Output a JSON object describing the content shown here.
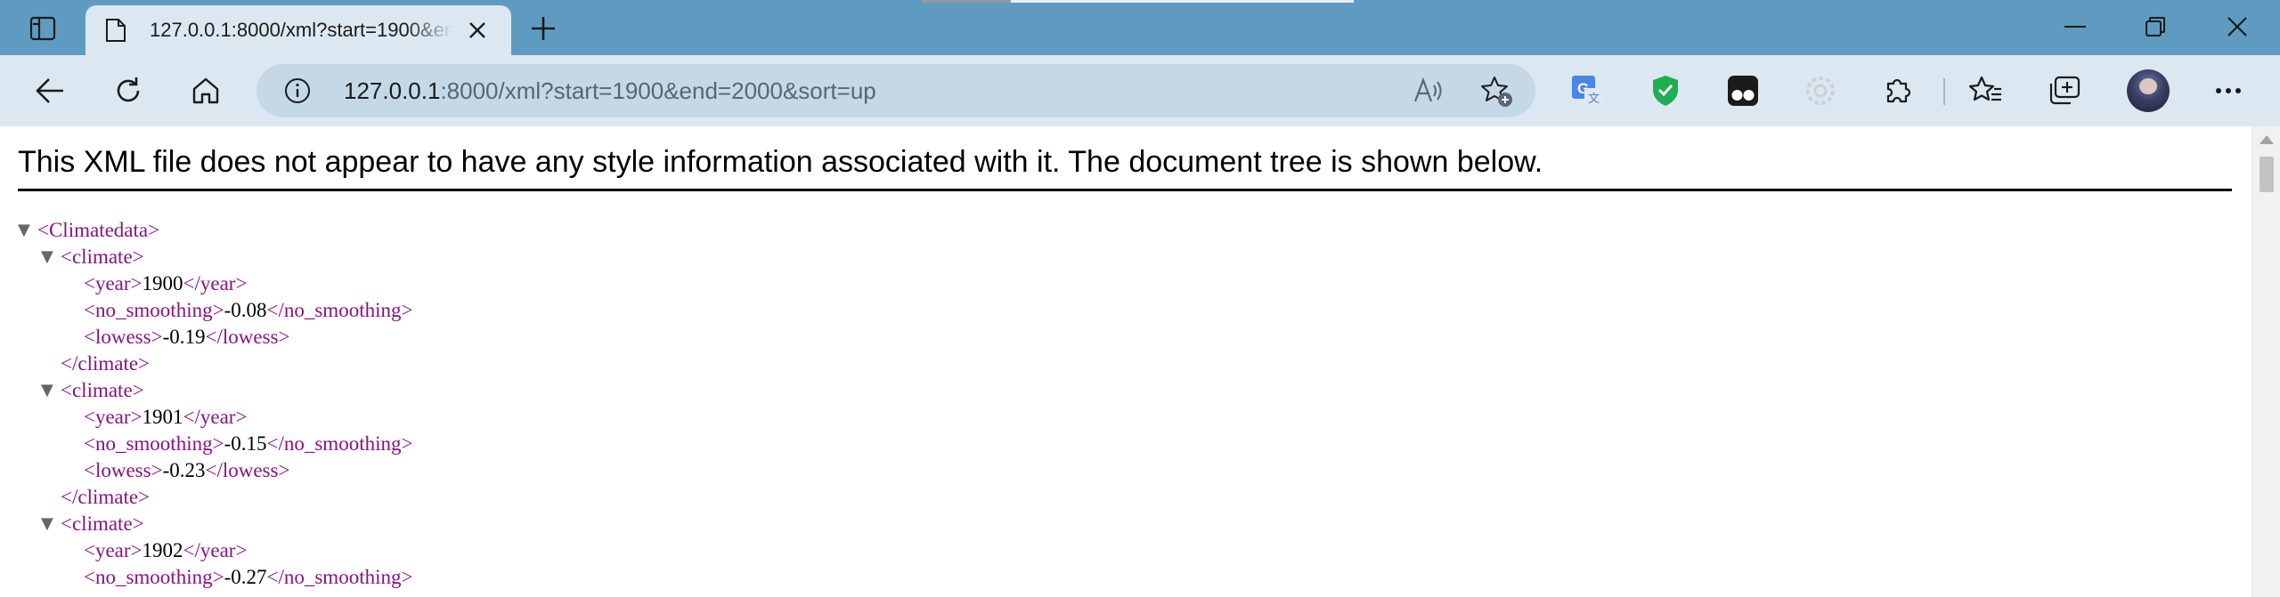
{
  "tab": {
    "title": "127.0.0.1:8000/xml?start=1900&end=2000&sort=up",
    "icon": "page-icon"
  },
  "address_bar": {
    "url_host": "127.0.0.1",
    "url_rest": ":8000/xml?start=1900&end=2000&sort=up"
  },
  "icons": {
    "sidebar": "sidebar-toggle-icon",
    "close_tab": "close-icon",
    "new_tab": "plus-icon",
    "minimize": "minimize-icon",
    "restore": "restore-icon",
    "close_window": "close-icon",
    "back": "back-arrow-icon",
    "refresh": "refresh-icon",
    "home": "home-icon",
    "info": "info-icon",
    "read_aloud": "read-aloud-icon",
    "add_favorite": "star-plus-icon",
    "translate_ext": "translate-extension-icon",
    "shield_ext": "shield-extension-icon",
    "tampermonkey_ext": "tampermonkey-extension-icon",
    "gray_ext": "gear-extension-icon",
    "extensions": "puzzle-icon",
    "favorites": "favorites-icon",
    "collections": "collections-icon",
    "profile": "avatar",
    "menu": "more-icon"
  },
  "colors": {
    "tabstrip": "#5f9bc0",
    "toolbar": "#dce8f1",
    "omnibox": "#c5d8e6",
    "xml_tag": "#881280"
  },
  "page": {
    "notice": "This XML file does not appear to have any style information associated with it. The document tree is shown below.",
    "root_open": "<Climatedata>",
    "climate_open": "<climate>",
    "climate_close": "</climate>",
    "tags": {
      "year_open": "<year>",
      "year_close": "</year>",
      "ns_open": "<no_smoothing>",
      "ns_close": "</no_smoothing>",
      "lw_open": "<lowess>",
      "lw_close": "</lowess>"
    },
    "records": [
      {
        "year": "1900",
        "no_smoothing": "-0.08",
        "lowess": "-0.19"
      },
      {
        "year": "1901",
        "no_smoothing": "-0.15",
        "lowess": "-0.23"
      },
      {
        "year": "1902",
        "no_smoothing": "-0.27"
      }
    ]
  }
}
